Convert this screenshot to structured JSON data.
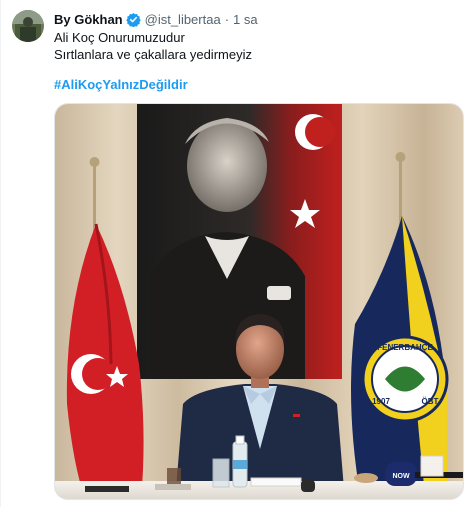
{
  "tweet": {
    "display_name": "By Gökhan",
    "handle": "@ist_libertaa",
    "separator": "·",
    "time": "1 sa",
    "text_lines": [
      "Ali Koç Onurumuzudur",
      "Sırtlanlara ve çakallara yedirmeyiz"
    ],
    "hashtag": "#AliKoçYalnızDeğildir"
  },
  "media": {
    "flag_logo_text_top": "FENERBAHÇE",
    "flag_logo_year_left": "1907",
    "flag_logo_year_right": "ÖBT",
    "mic_label": "NOW"
  },
  "icons": {
    "verified": "verified-badge-icon"
  },
  "colors": {
    "accent": "#1d9bf0",
    "secondary_text": "#536471"
  }
}
